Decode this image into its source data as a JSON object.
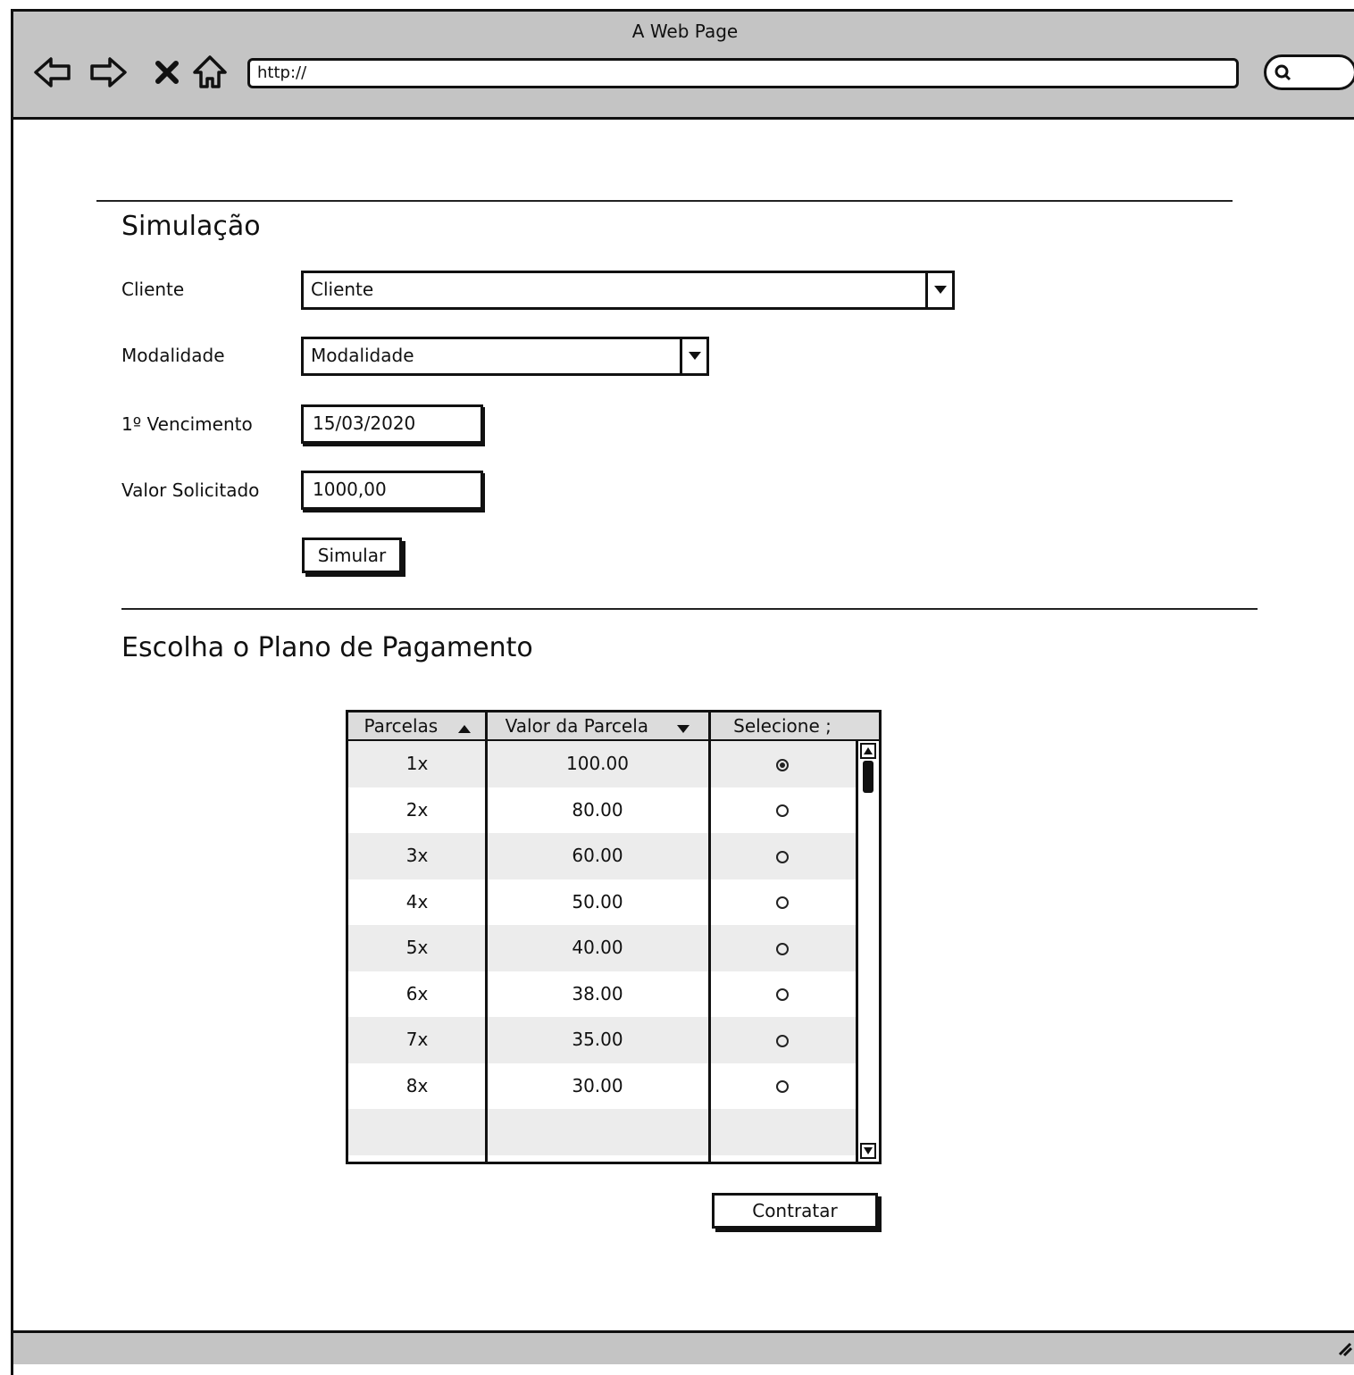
{
  "browser": {
    "title": "A Web Page",
    "url": "http://"
  },
  "simulacao": {
    "title": "Simulação",
    "cliente_label": "Cliente",
    "cliente_value": "Cliente",
    "modalidade_label": "Modalidade",
    "modalidade_value": "Modalidade",
    "vencimento_label": "1º Vencimento",
    "vencimento_value": "15/03/2020",
    "valor_label": "Valor Solicitado",
    "valor_value": "1000,00",
    "simular_label": "Simular"
  },
  "plano": {
    "title": "Escolha o Plano de Pagamento",
    "columns": [
      "Parcelas",
      "Valor da Parcela",
      "Selecione ;"
    ],
    "rows": [
      {
        "parcelas": "1x",
        "valor": "100.00",
        "selected": true
      },
      {
        "parcelas": "2x",
        "valor": "80.00",
        "selected": false
      },
      {
        "parcelas": "3x",
        "valor": "60.00",
        "selected": false
      },
      {
        "parcelas": "4x",
        "valor": "50.00",
        "selected": false
      },
      {
        "parcelas": "5x",
        "valor": "40.00",
        "selected": false
      },
      {
        "parcelas": "6x",
        "valor": "38.00",
        "selected": false
      },
      {
        "parcelas": "7x",
        "valor": "35.00",
        "selected": false
      },
      {
        "parcelas": "8x",
        "valor": "30.00",
        "selected": false
      }
    ],
    "contratar_label": "Contratar"
  }
}
